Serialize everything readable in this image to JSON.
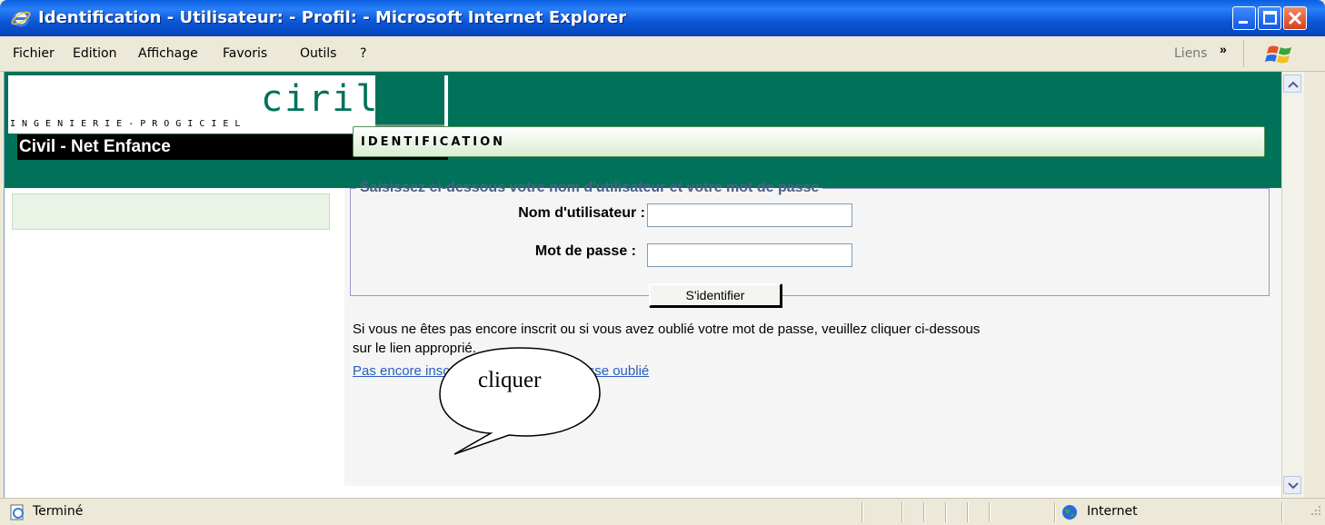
{
  "window": {
    "title": "Identification - Utilisateur: - Profil: - Microsoft Internet Explorer"
  },
  "menubar": {
    "items": [
      "Fichier",
      "Edition",
      "Affichage",
      "Favoris",
      "Outils",
      "?"
    ],
    "links_label": "Liens",
    "chevron": "»"
  },
  "header": {
    "logo_word": "ciril",
    "logo_tagline": "INGENIERIE-PROGICIEL",
    "app_name": "Civil - Net Enfance"
  },
  "section": {
    "title": "IDENTIFICATION"
  },
  "login": {
    "legend": "Saisissez ci-dessous votre nom d'utilisateur et votre mot de passe",
    "username_label": "Nom d'utilisateur :",
    "username_value": "",
    "password_label": "Mot de passe :",
    "password_value": "",
    "submit_label": "S'identifier"
  },
  "help": {
    "text_line1": "Si vous ne êtes pas encore inscrit ou si vous avez oublié votre mot de passe, veuillez cliquer ci-dessous",
    "text_line2": "sur le lien approprié.",
    "link_signup": "Pas encore inscrit ?",
    "link_forgot": "Mot de passe oublié"
  },
  "annotation": {
    "bubble_text": "cliquer"
  },
  "status": {
    "text": "Terminé",
    "zone": "Internet"
  },
  "colors": {
    "brand_green": "#00725a",
    "link_blue": "#2a5dc0",
    "xp_title_blue": "#0b57d8"
  }
}
